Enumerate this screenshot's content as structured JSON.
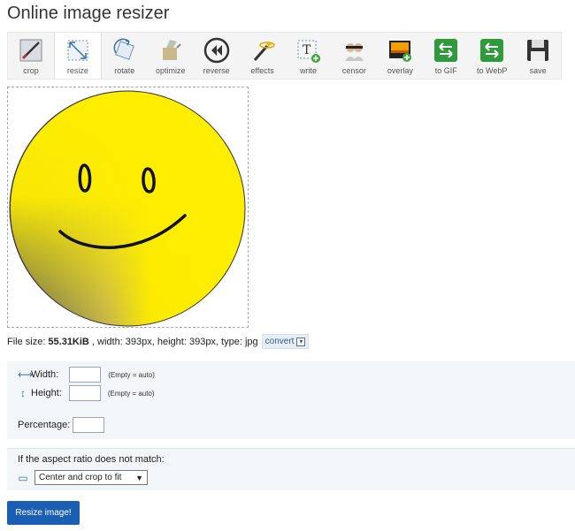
{
  "header": {
    "title": "Online image resizer"
  },
  "toolbar": {
    "items": [
      {
        "label": "crop",
        "icon": "crop-icon"
      },
      {
        "label": "resize",
        "icon": "resize-icon",
        "active": true
      },
      {
        "label": "rotate",
        "icon": "rotate-icon"
      },
      {
        "label": "optimize",
        "icon": "optimize-icon"
      },
      {
        "label": "reverse",
        "icon": "reverse-icon"
      },
      {
        "label": "effects",
        "icon": "effects-icon"
      },
      {
        "label": "write",
        "icon": "write-icon"
      },
      {
        "label": "censor",
        "icon": "censor-icon"
      },
      {
        "label": "overlay",
        "icon": "overlay-icon"
      },
      {
        "label": "to GIF",
        "icon": "to-gif-icon"
      },
      {
        "label": "to WebP",
        "icon": "to-webp-icon"
      },
      {
        "label": "save",
        "icon": "save-icon"
      }
    ]
  },
  "file_info": {
    "size_label": "File size:",
    "size_value": "55.31KiB",
    "details": ", width: 393px, height: 393px, type: jpg",
    "convert_label": "convert"
  },
  "form": {
    "width_label": "Width:",
    "width_value": "",
    "width_hint": "(Empty = auto)",
    "height_label": "Height:",
    "height_value": "",
    "height_hint": "(Empty = auto)",
    "percentage_label": "Percentage:",
    "percentage_value": "",
    "aspect_label": "If the aspect ratio does not match:",
    "aspect_selected": "Center and crop to fit",
    "submit_label": "Resize image!"
  },
  "colors": {
    "accent": "#1a5fb4",
    "panel": "#f3f6f9",
    "smiley": "#ffee00"
  }
}
